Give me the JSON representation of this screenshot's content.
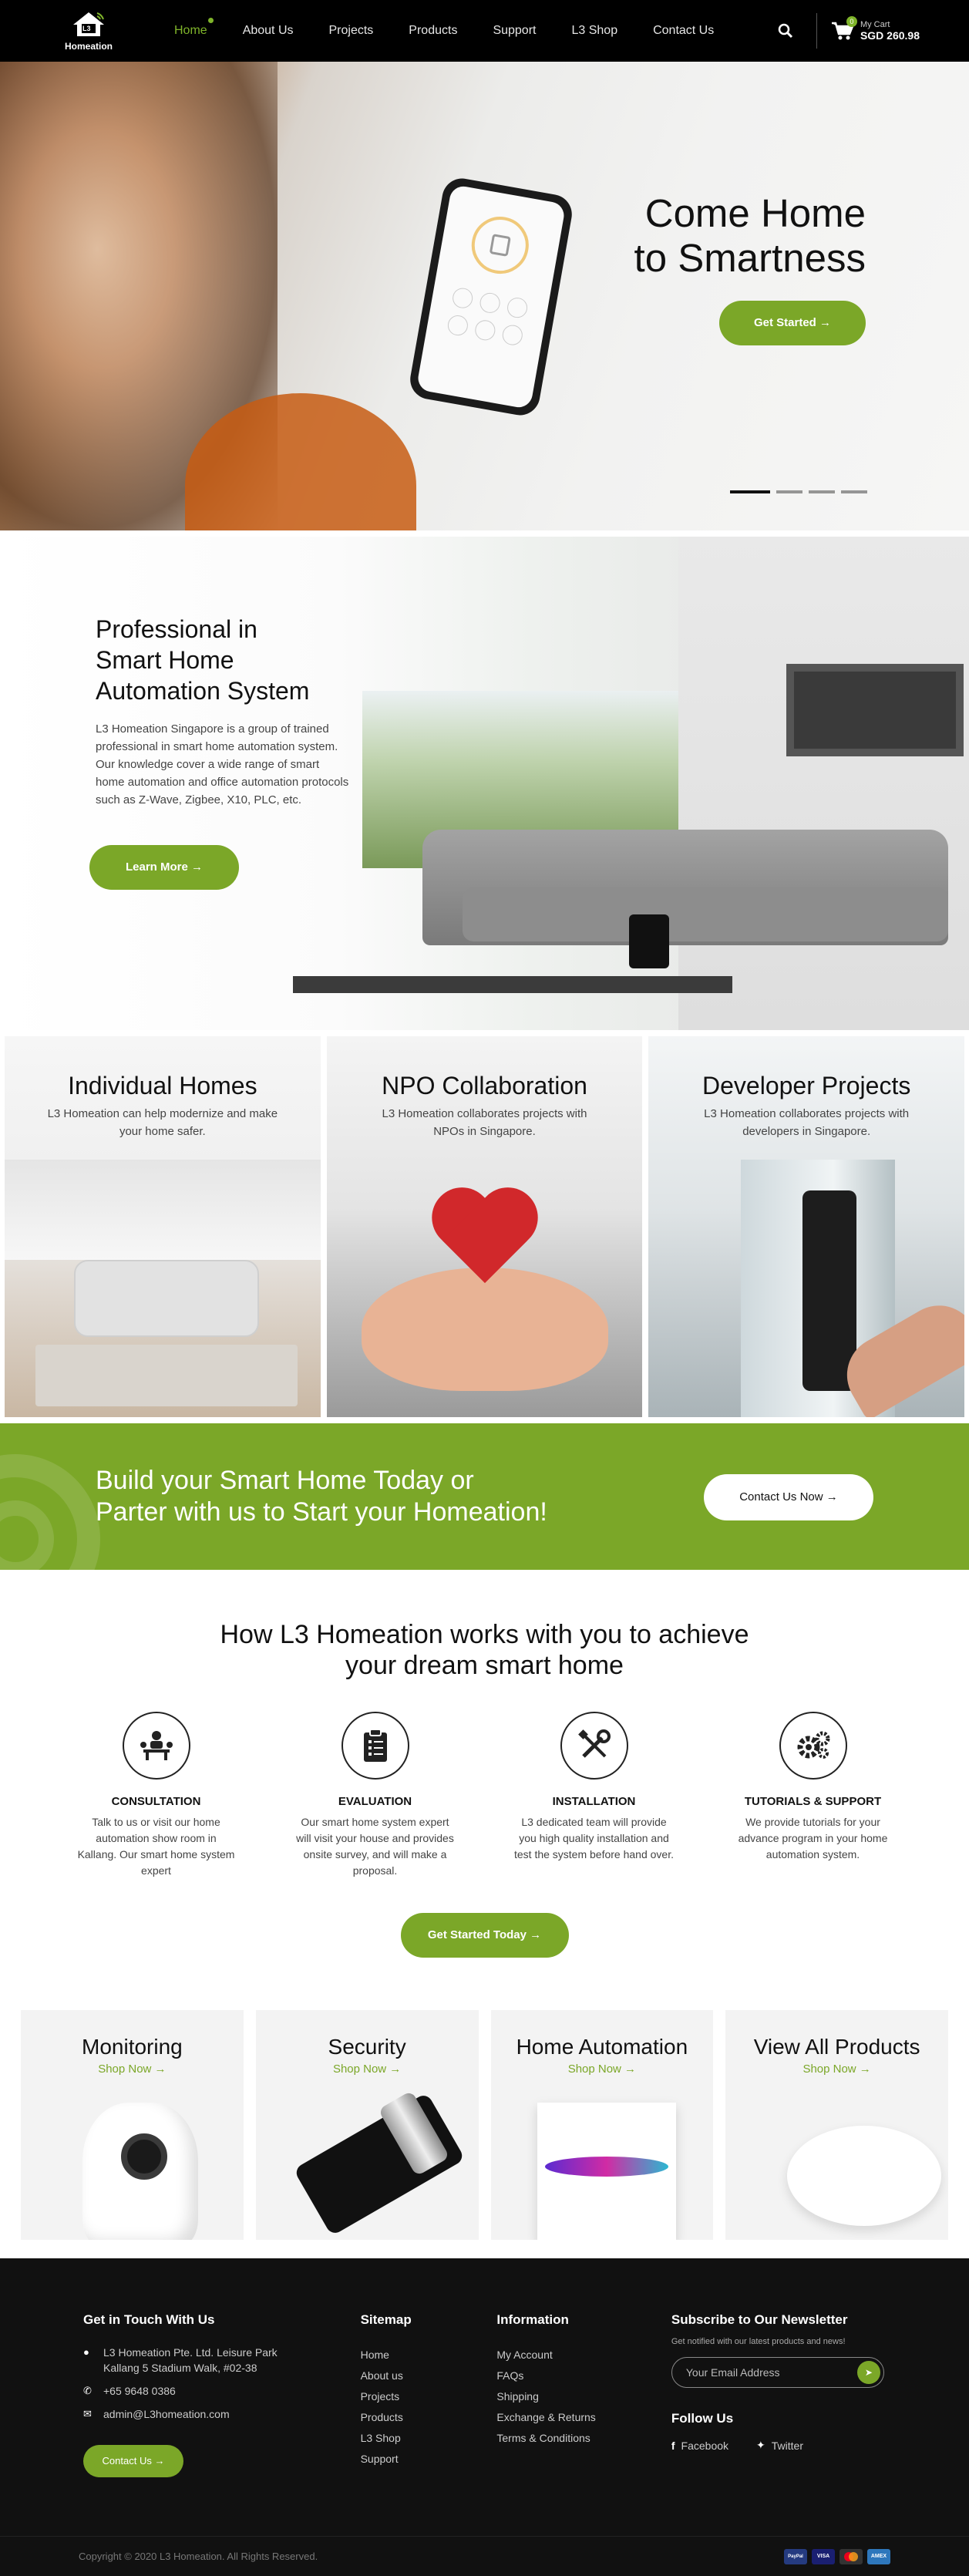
{
  "nav": {
    "logo_text": "Homeation",
    "logo_mark": "L3",
    "items": [
      {
        "label": "Home",
        "active": true
      },
      {
        "label": "About Us"
      },
      {
        "label": "Projects"
      },
      {
        "label": "Products"
      },
      {
        "label": "Support"
      },
      {
        "label": "L3 Shop"
      },
      {
        "label": "Contact Us"
      }
    ],
    "cart_count": "0",
    "cart_label": "My Cart",
    "cart_total": "SGD 260.98"
  },
  "hero": {
    "title_line1": "Come Home",
    "title_line2": "to Smartness",
    "cta": "Get Started →",
    "slides": 4,
    "active_slide": 1
  },
  "about": {
    "title_line1": "Professional in",
    "title_line2": "Smart Home",
    "title_line3": "Automation System",
    "text": "L3 Homeation Singapore is a group of trained professional in smart home automation system. Our knowledge cover a wide range of smart home automation and office automation protocols such as Z-Wave, Zigbee, X10, PLC, etc.",
    "cta": "Learn More →"
  },
  "categories": [
    {
      "title": "Individual Homes",
      "text": "L3 Homeation can help modernize and make your home safer."
    },
    {
      "title": "NPO Collaboration",
      "text": "L3 Homeation collaborates projects with NPOs in Singapore."
    },
    {
      "title": "Developer Projects",
      "text": "L3 Homeation collaborates projects with developers in Singapore."
    }
  ],
  "band": {
    "title_line1": "Build your Smart Home Today or",
    "title_line2": "Parter with us to Start your Homeation!",
    "cta": "Contact Us Now →"
  },
  "how": {
    "title_line1": "How L3 Homeation works with you to achieve",
    "title_line2": "your dream smart home",
    "steps": [
      {
        "title": "CONSULTATION",
        "text": "Talk to us or visit our home automation show room in Kallang. Our smart home system expert",
        "icon": "consultation-icon"
      },
      {
        "title": "EVALUATION",
        "text": "Our smart home system expert will visit your house and provides onsite survey, and will make a proposal.",
        "icon": "clipboard-icon"
      },
      {
        "title": "INSTALLATION",
        "text": "L3 dedicated team will provide you high quality installation and test the system before hand over.",
        "icon": "tools-icon"
      },
      {
        "title": "TUTORIALS & SUPPORT",
        "text": "We provide tutorials for your advance program in your home automation system.",
        "icon": "gears-icon"
      }
    ],
    "cta": "Get Started Today →"
  },
  "products": [
    {
      "title": "Monitoring",
      "link": "Shop Now →"
    },
    {
      "title": "Security",
      "link": "Shop Now →"
    },
    {
      "title": "Home Automation",
      "link": "Shop Now →"
    },
    {
      "title": "View All Products",
      "link": "Shop Now →"
    }
  ],
  "footer": {
    "contact": {
      "title": "Get in Touch With Us",
      "address_line1": "L3 Homeation Pte. Ltd. Leisure Park",
      "address_line2": "Kallang 5 Stadium Walk, #02-38",
      "phone": "+65 9648 0386",
      "email": "admin@L3homeation.com",
      "cta": "Contact Us →"
    },
    "sitemap": {
      "title": "Sitemap",
      "links": [
        "Home",
        "About us",
        "Projects",
        "Products",
        "L3 Shop",
        "Support"
      ]
    },
    "information": {
      "title": "Information",
      "links": [
        "My Account",
        "FAQs",
        "Shipping",
        "Exchange & Returns",
        "Terms & Conditions"
      ]
    },
    "newsletter": {
      "title": "Subscribe to Our Newsletter",
      "note": "Get notified with our latest products and news!",
      "placeholder": "Your Email Address",
      "follow_title": "Follow Us",
      "facebook": "Facebook",
      "twitter": "Twitter"
    },
    "copyright": "Copyright © 2020 L3 Homeation. All Rights Reserved.",
    "payments": [
      "PayPal",
      "VISA",
      "Mastercard",
      "AMEX"
    ]
  },
  "colors": {
    "accent": "#7ba728",
    "nav_bg": "#000000",
    "footer_bg": "#111111"
  }
}
